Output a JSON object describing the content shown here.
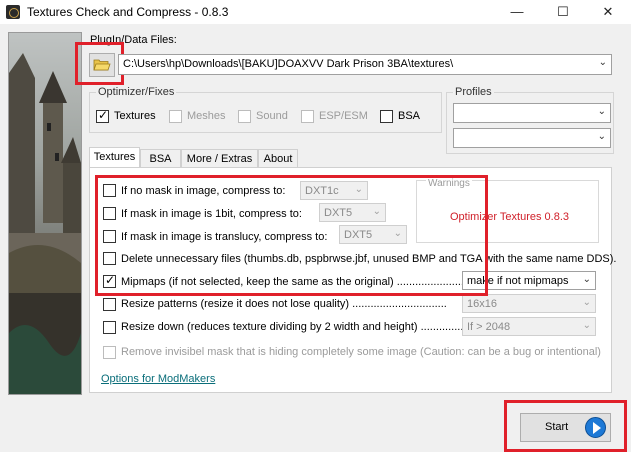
{
  "window": {
    "title": "Textures Check and Compress - 0.8.3",
    "minimize_glyph": "—",
    "maximize_glyph": "☐",
    "close_glyph": "✕"
  },
  "plugin": {
    "label": "PlugIn/Data Files:",
    "path": "C:\\Users\\hp\\Downloads\\[BAKU]DOAXVV Dark Prison 3BA\\textures\\"
  },
  "optimizer": {
    "label": "Optimizer/Fixes",
    "options": [
      {
        "label": "Textures",
        "checked": true,
        "enabled": true
      },
      {
        "label": "Meshes",
        "checked": false,
        "enabled": false
      },
      {
        "label": "Sound",
        "checked": false,
        "enabled": false
      },
      {
        "label": "ESP/ESM",
        "checked": false,
        "enabled": false
      },
      {
        "label": "BSA",
        "checked": false,
        "enabled": true
      }
    ]
  },
  "profiles": {
    "label": "Profiles",
    "value1": "",
    "value2": ""
  },
  "tabs": [
    "Textures",
    "BSA",
    "More / Extras",
    "About"
  ],
  "textures": {
    "rows": [
      {
        "label": "If no mask in image, compress to:",
        "checked": false,
        "select": "DXT1c"
      },
      {
        "label": "If mask in image is 1bit, compress to:",
        "checked": false,
        "select": "DXT5"
      },
      {
        "label": "If mask in image is translucy, compress to:",
        "checked": false,
        "select": "DXT5"
      },
      {
        "label": "Delete unnecessary files (thumbs.db, pspbrwse.jbf, unused BMP and TGA with the same name DDS).",
        "checked": false
      },
      {
        "label": "Mipmaps (if not selected, keep the same as the original) ..............................",
        "checked": true,
        "select": "make if not mipmaps"
      },
      {
        "label": "Resize patterns (resize it does not lose quality) ...............................",
        "checked": false,
        "select": "16x16"
      },
      {
        "label": "Resize down (reduces texture dividing by 2 width and height) ...............",
        "checked": false,
        "select": "If > 2048"
      },
      {
        "label": "Remove invisibel mask that is hiding completely some image (Caution: can be a bug or intentional)",
        "checked": false,
        "enabled": false
      }
    ],
    "warnings_label": "Warnings",
    "warnings_text": "Optimizer Textures 0.8.3",
    "modmakers_link": "Options for ModMakers"
  },
  "start_label": "Start",
  "colors": {
    "highlight": "#e0202a",
    "warning_text": "#d0202a",
    "link": "#0a6e7a",
    "start_icon": "#1d79d6"
  },
  "icons": {
    "folder": "folder-icon",
    "dropdown": "chevron-down-icon",
    "start": "play-icon"
  }
}
